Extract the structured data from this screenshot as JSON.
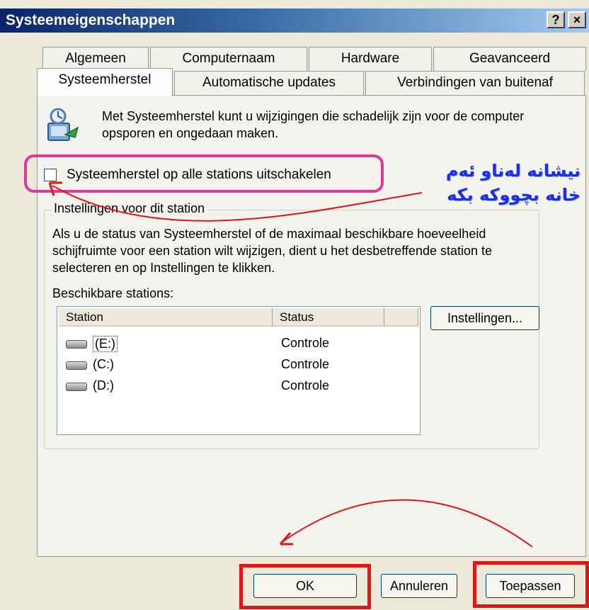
{
  "window": {
    "title": "Systeemeigenschappen",
    "help_glyph": "?",
    "close_glyph": "×"
  },
  "tabs": {
    "row1": [
      "Algemeen",
      "Computernaam",
      "Hardware",
      "Geavanceerd"
    ],
    "row2": [
      "Systeemherstel",
      "Automatische updates",
      "Verbindingen van buitenaf"
    ]
  },
  "intro_text": "Met Systeemherstel kunt u wijzigingen die schadelijk zijn voor de computer opsporen en ongedaan maken.",
  "disable_checkbox": {
    "label": "Systeemherstel op alle stations uitschakelen",
    "checked": false
  },
  "annotation": {
    "line1": "نیشانە لەناو ئەم",
    "line2": "خانە بچووکە بکە",
    "color": "#1a2fe0"
  },
  "group": {
    "title": "Instellingen voor dit station",
    "description": "Als u de status van Systeemherstel of de maximaal beschikbare hoeveelheid schijfruimte voor een station wilt wijzigen, dient u het desbetreffende station te selecteren en op Instellingen te klikken.",
    "available_label": "Beschikbare stations:",
    "columns": [
      "Station",
      "Status"
    ],
    "drives": [
      {
        "name": "(E:)",
        "status": "Controle",
        "icon": "drive-icon"
      },
      {
        "name": "(C:)",
        "status": "Controle",
        "icon": "drive-icon"
      },
      {
        "name": "(D:)",
        "status": "Controle",
        "icon": "drive-icon"
      }
    ],
    "settings_button": "Instellingen..."
  },
  "buttons": {
    "ok": "OK",
    "cancel": "Annuleren",
    "apply": "Toepassen"
  },
  "colors": {
    "highlight_pink": "#e0379b",
    "highlight_red": "#e01515",
    "title_bar": "#0a246a"
  }
}
